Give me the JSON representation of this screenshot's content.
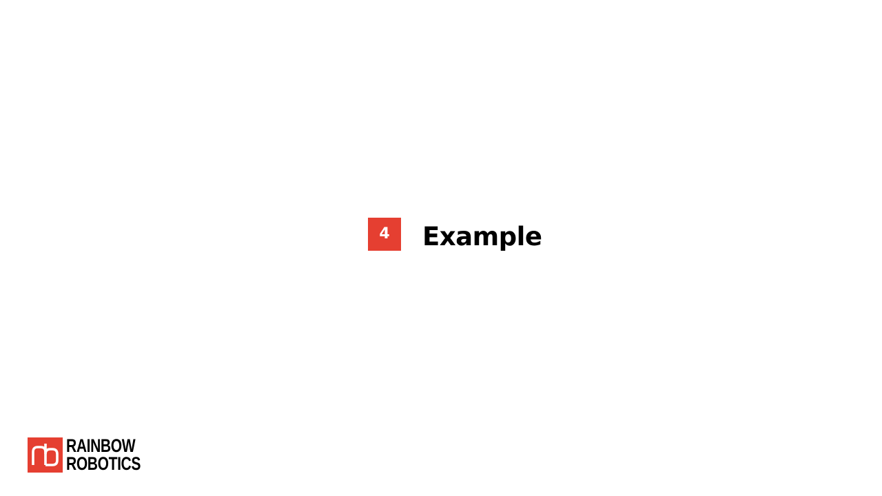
{
  "section": {
    "number": "4",
    "title": "Example"
  },
  "logo": {
    "line1": "RAINBOW",
    "line2": "ROBOTICS"
  },
  "colors": {
    "accent": "#e53f31",
    "text": "#000000",
    "background": "#ffffff"
  }
}
